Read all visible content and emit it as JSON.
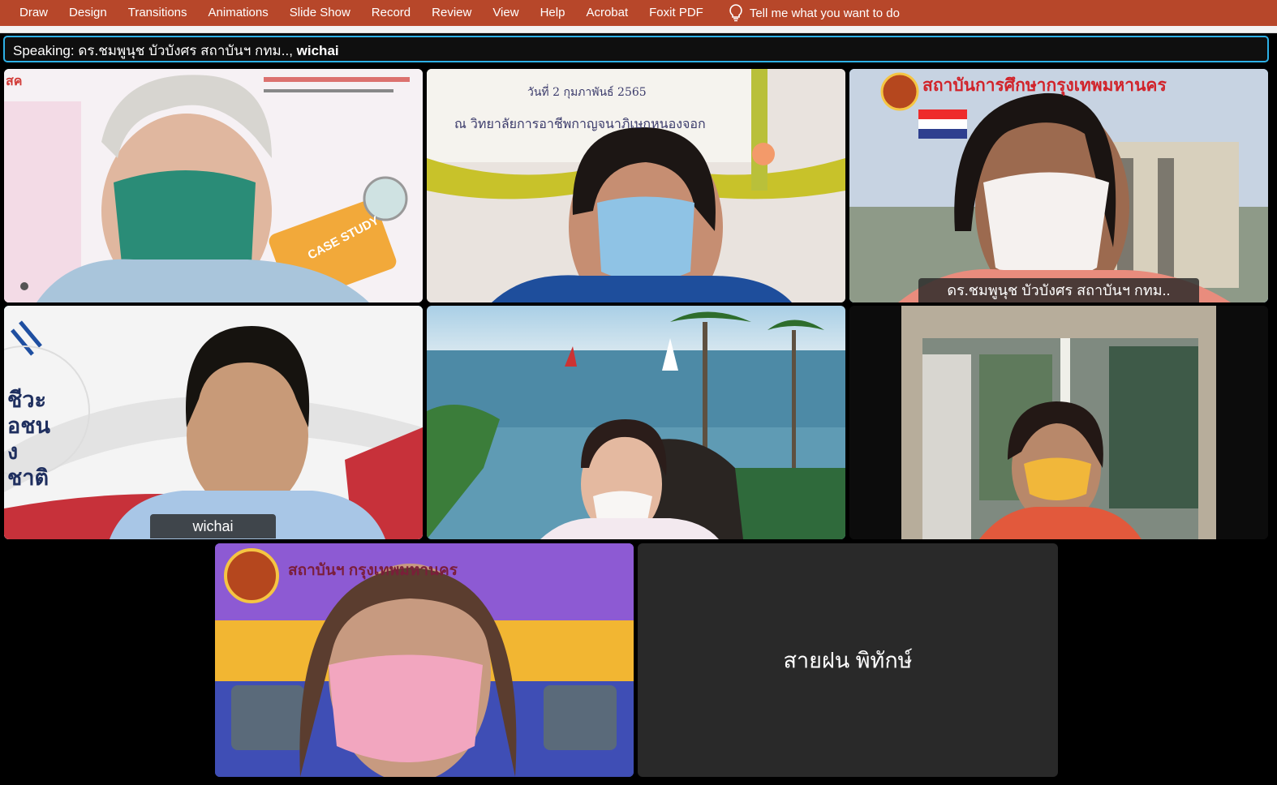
{
  "ribbon": {
    "tabs": [
      "Draw",
      "Design",
      "Transitions",
      "Animations",
      "Slide Show",
      "Record",
      "Review",
      "View",
      "Help",
      "Acrobat",
      "Foxit PDF"
    ],
    "tell_me": "Tell me what you want to do",
    "color": "#b7472a",
    "icon": "lightbulb-icon"
  },
  "speaking": {
    "prefix": "Speaking: ",
    "names": "ดร.ชมพูนุช บัวบังศร สถาบันฯ กทม..",
    "sep": ", ",
    "second": "wichai"
  },
  "tiles": {
    "t3_name": "ดร.ชมพูนุช บัวบังศร สถาบันฯ กทม..",
    "t4_name": "wichai",
    "t8_name": "สายฝน พิทักษ์",
    "t1_card": "CASE STUDY",
    "t1_badge": "สค",
    "t2_banner1": "วันที่ 2 กุมภาพันธ์ 2565",
    "t2_banner2": "ณ วิทยาลัยการอาชีพกาญจนาภิเษกหนองจอก",
    "t3_banner": "สถาบันการศึกษากรุงเทพมหานคร",
    "t4_side": "ชีวะ อชน งชาติ",
    "t7_banner": "สถาบันฯ กรุงเทพมหานคร"
  },
  "accent": "#2db0e6"
}
